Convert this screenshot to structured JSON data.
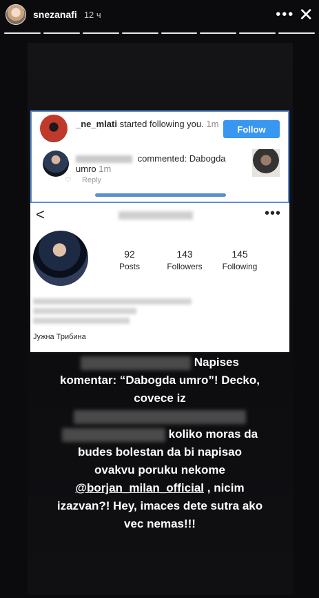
{
  "story": {
    "username": "snezanafi",
    "time": "12 ч",
    "more_label": "•••",
    "close_label": "✕",
    "progress_segments": 8
  },
  "notification": {
    "follow_user": "_ne_mlati",
    "follow_text": "started following you.",
    "follow_time": "1m",
    "follow_button": "Follow",
    "comment_text": "commented: Dabogda umro",
    "comment_time": "1m",
    "reply_label": "Reply"
  },
  "profile": {
    "back_label": "<",
    "more_label": "•••",
    "stats": [
      {
        "value": "92",
        "label": "Posts"
      },
      {
        "value": "143",
        "label": "Followers"
      },
      {
        "value": "145",
        "label": "Following"
      }
    ],
    "bio_name": "Јужна Трибина"
  },
  "caption": {
    "p1": "Napises komentar: “Dabogda umro”! Decko, covece iz",
    "p2": "koliko moras da budes bolestan da bi napisao ovakvu poruku nekome",
    "mention": "@borjan_milan_official",
    "p3": ", nicim izazvan?! Hey, imaces dete sutra ako vec nemas!!!"
  },
  "colors": {
    "follow_blue": "#3897f0",
    "frame_blue": "#5a8fd6",
    "background": "#0b0b0d"
  }
}
